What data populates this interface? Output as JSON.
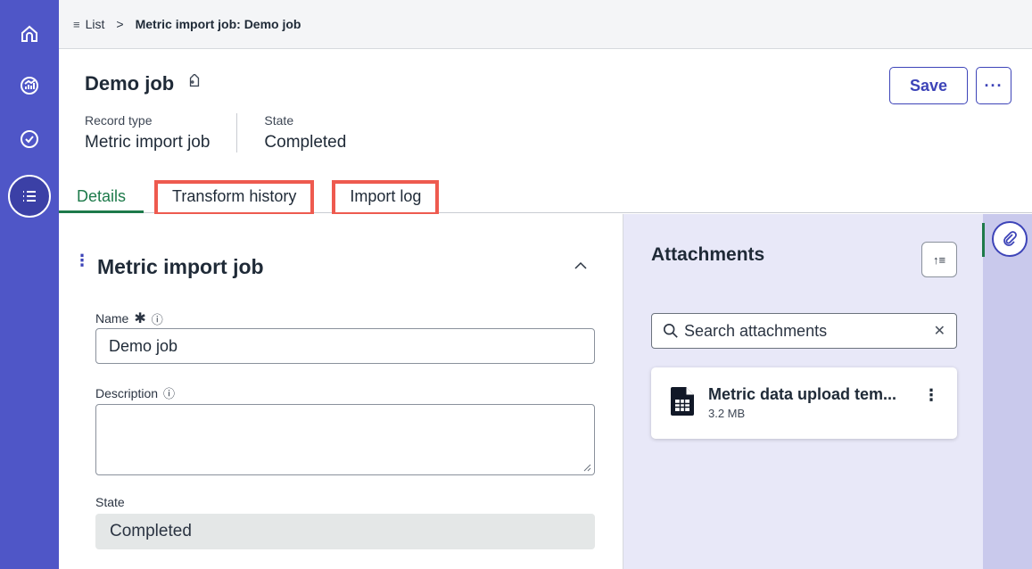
{
  "breadcrumb": {
    "list_label": "List",
    "separator": ">",
    "current": "Metric import job: Demo job"
  },
  "header": {
    "title": "Demo job",
    "meta": [
      {
        "label": "Record type",
        "value": "Metric import job"
      },
      {
        "label": "State",
        "value": "Completed"
      }
    ],
    "save_label": "Save",
    "more_label": "···"
  },
  "tabs": [
    {
      "label": "Details",
      "active": true
    },
    {
      "label": "Transform history",
      "highlighted": true
    },
    {
      "label": "Import log",
      "highlighted": true
    }
  ],
  "section": {
    "title": "Metric import job",
    "fields": {
      "name_label": "Name",
      "name_value": "Demo job",
      "description_label": "Description",
      "description_value": "",
      "state_label": "State",
      "state_value": "Completed"
    }
  },
  "attachments": {
    "title": "Attachments",
    "search_placeholder": "Search attachments",
    "files": [
      {
        "name": "Metric data upload tem...",
        "size": "3.2 MB"
      }
    ]
  },
  "colors": {
    "rail": "#4f56c7",
    "accent": "#3d44b8",
    "active_tab": "#1d7a4a",
    "highlight": "#ee5a4f",
    "attach_bg": "#e8e8f8"
  },
  "icons": [
    "home-icon",
    "analytics-icon",
    "check-circle-icon",
    "list-icon",
    "tag-icon",
    "chevron-up-icon",
    "info-icon",
    "search-icon",
    "close-icon",
    "sort-icon",
    "spreadsheet-file-icon",
    "paperclip-icon"
  ]
}
